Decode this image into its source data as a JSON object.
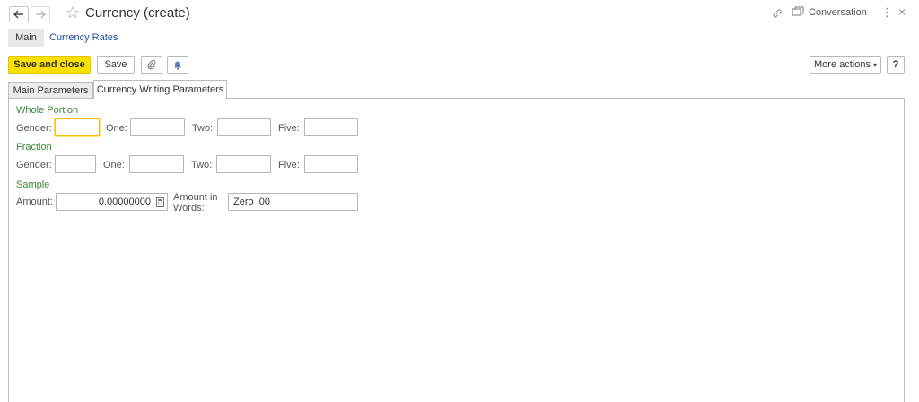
{
  "window": {
    "title": "Currency (create)",
    "conversation_label": "Conversation"
  },
  "nav": {
    "main_label": "Main",
    "currency_rates_label": "Currency Rates"
  },
  "toolbar": {
    "save_close_label": "Save and close",
    "save_label": "Save",
    "more_actions_label": "More actions",
    "help_label": "?"
  },
  "tabs": [
    {
      "label": "Main Parameters"
    },
    {
      "label": "Currency Writing Parameters"
    }
  ],
  "whole_portion": {
    "title": "Whole Portion",
    "gender_label": "Gender:",
    "one_label": "One:",
    "two_label": "Two:",
    "five_label": "Five:",
    "gender_value": "",
    "one_value": "",
    "two_value": "",
    "five_value": ""
  },
  "fraction": {
    "title": "Fraction",
    "gender_label": "Gender:",
    "one_label": "One:",
    "two_label": "Two:",
    "five_label": "Five:",
    "gender_value": "",
    "one_value": "",
    "two_value": "",
    "five_value": ""
  },
  "sample": {
    "title": "Sample",
    "amount_label": "Amount:",
    "amount_value": "0.00000000",
    "amount_in_words_label_1": "Amount in",
    "amount_in_words_label_2": "Words:",
    "amount_in_words_value": "Zero  00"
  }
}
